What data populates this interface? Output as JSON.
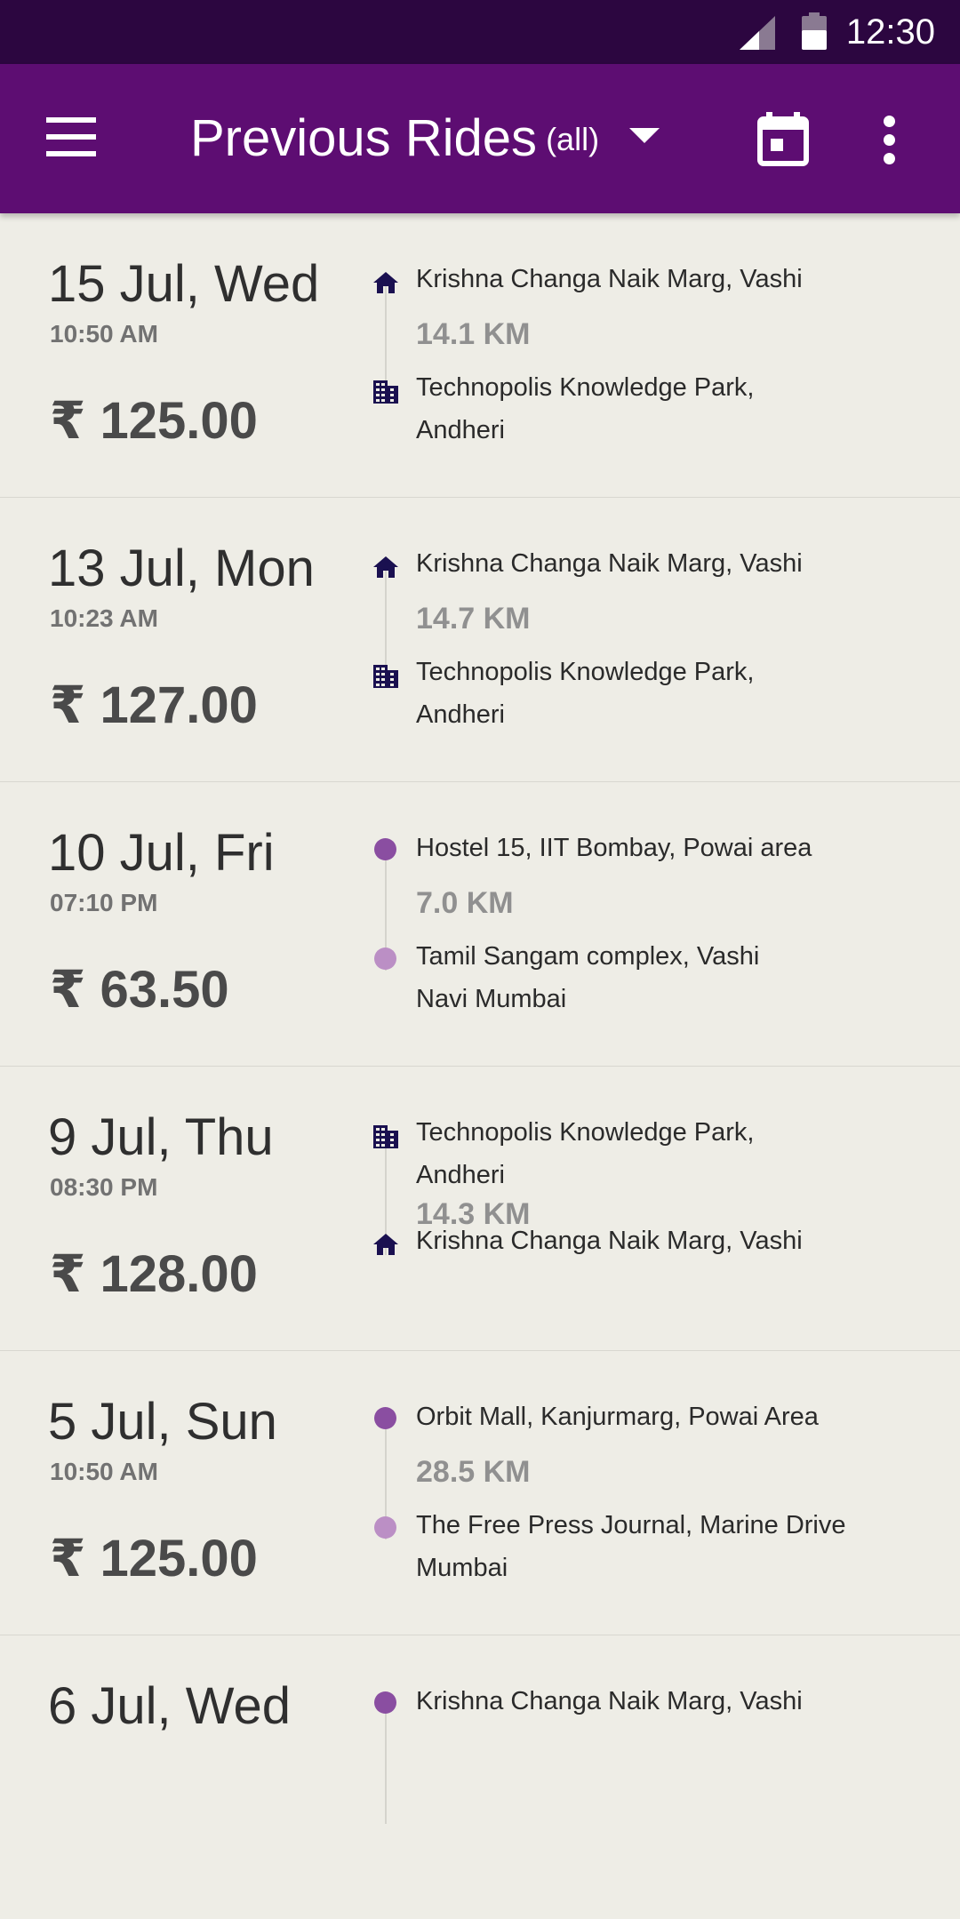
{
  "status_bar": {
    "time": "12:30",
    "icons": [
      "signal-icon",
      "battery-icon"
    ]
  },
  "app_bar": {
    "title": "Previous Rides",
    "filter": "(all)",
    "icons": [
      "menu-icon",
      "dropdown-arrow-icon",
      "calendar-icon",
      "more-vert-icon"
    ]
  },
  "colors": {
    "status_bar": "#2c0640",
    "app_bar": "#5d0d72",
    "background": "#eeede6",
    "pickup_dot": "#8a4ea1",
    "drop_dot": "#bb8fc5",
    "place_icon": "#1a1050"
  },
  "rides": [
    {
      "date": "15 Jul, Wed",
      "time": "10:50 AM",
      "fare": "₹ 125.00",
      "from": "Krishna Changa Naik Marg, Vashi",
      "from_icon": "home-icon",
      "distance": "14.1 KM",
      "to": "Technopolis Knowledge Park, Andheri",
      "to_icon": "office-icon"
    },
    {
      "date": "13 Jul, Mon",
      "time": "10:23 AM",
      "fare": "₹ 127.00",
      "from": "Krishna Changa Naik Marg, Vashi",
      "from_icon": "home-icon",
      "distance": "14.7 KM",
      "to": "Technopolis Knowledge Park, Andheri",
      "to_icon": "office-icon"
    },
    {
      "date": "10 Jul, Fri",
      "time": "07:10 PM",
      "fare": "₹ 63.50",
      "from": "Hostel 15, IIT Bombay, Powai area",
      "from_icon": "pickup-dot-icon",
      "distance": "7.0 KM",
      "to": "Tamil Sangam complex, Vashi Navi Mumbai",
      "to_icon": "drop-dot-icon"
    },
    {
      "date": "9 Jul, Thu",
      "time": "08:30 PM",
      "fare": "₹ 128.00",
      "from": "Technopolis Knowledge Park, Andheri",
      "from_icon": "office-icon",
      "distance": "14.3 KM",
      "to": "Krishna Changa Naik Marg, Vashi",
      "to_icon": "home-icon"
    },
    {
      "date": "5 Jul, Sun",
      "time": "10:50 AM",
      "fare": "₹ 125.00",
      "from": "Orbit Mall, Kanjurmarg, Powai Area",
      "from_icon": "pickup-dot-icon",
      "distance": "28.5 KM",
      "to": "The Free Press Journal, Marine Drive Mumbai",
      "to_icon": "drop-dot-icon"
    },
    {
      "date": "6 Jul, Wed",
      "from": "Krishna Changa Naik Marg, Vashi",
      "from_icon": "pickup-dot-icon"
    }
  ]
}
